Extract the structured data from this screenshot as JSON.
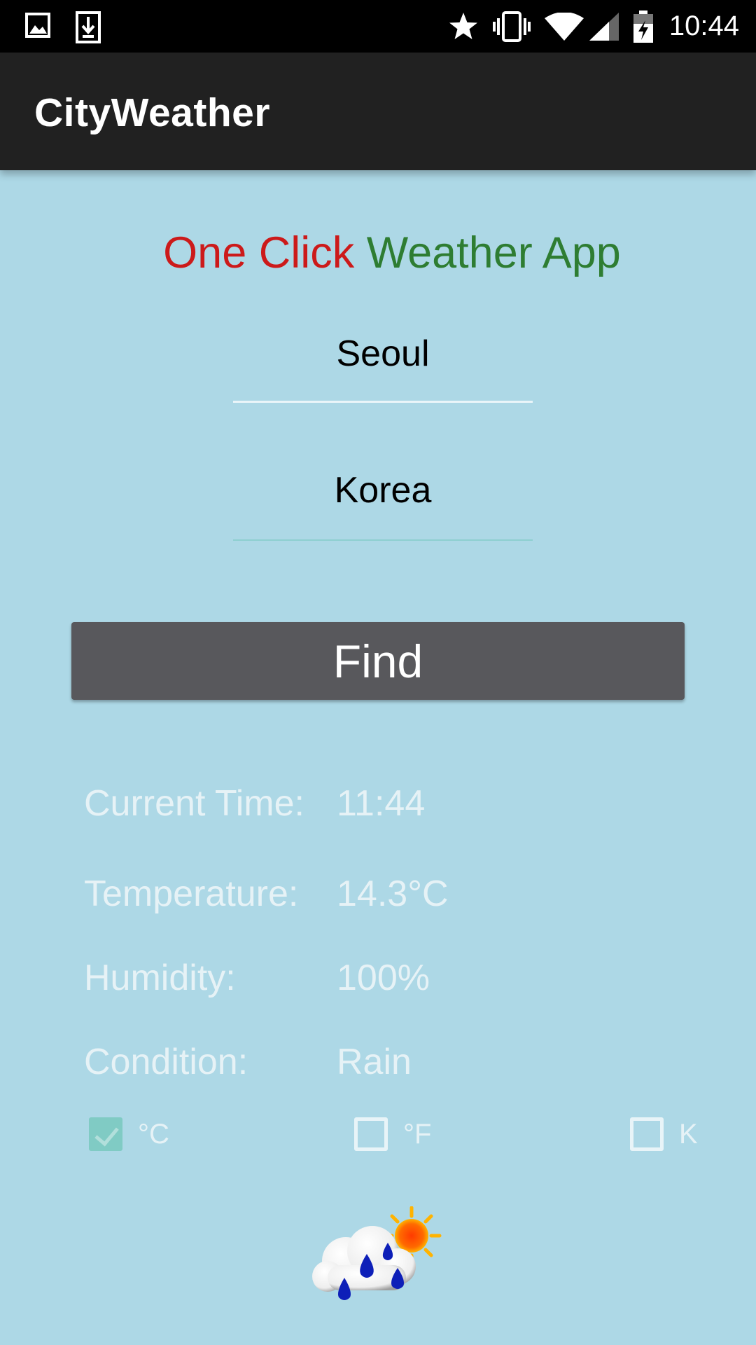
{
  "status_bar": {
    "time": "10:44",
    "left_icons": [
      "image-icon",
      "download-icon"
    ],
    "right_icons": [
      "star-icon",
      "vibrate-icon",
      "wifi-icon",
      "signal-icon",
      "battery-charging-icon"
    ]
  },
  "app_bar": {
    "title": "CityWeather"
  },
  "headline": {
    "part1": "One Click",
    "part2": "Weather App",
    "part1_color": "#cc1a1a",
    "part2_color": "#2e7d32"
  },
  "form": {
    "city_value": "Seoul",
    "country_value": "Korea",
    "find_label": "Find"
  },
  "info": {
    "time_label": "Current Time:",
    "time_value": "11:44",
    "temp_label": "Temperature:",
    "temp_value": "14.3°C",
    "humidity_label": "Humidity:",
    "humidity_value": "100%",
    "condition_label": "Condition:",
    "condition_value": "Rain"
  },
  "units": {
    "celsius_label": "°C",
    "fahrenheit_label": "°F",
    "kelvin_label": "K",
    "selected": "celsius"
  },
  "weather_icon": "rain-cloud-sun-icon",
  "colors": {
    "background": "#add8e6",
    "app_bar": "#212121",
    "button": "#58585c",
    "checkbox_checked": "#80cbc4"
  }
}
